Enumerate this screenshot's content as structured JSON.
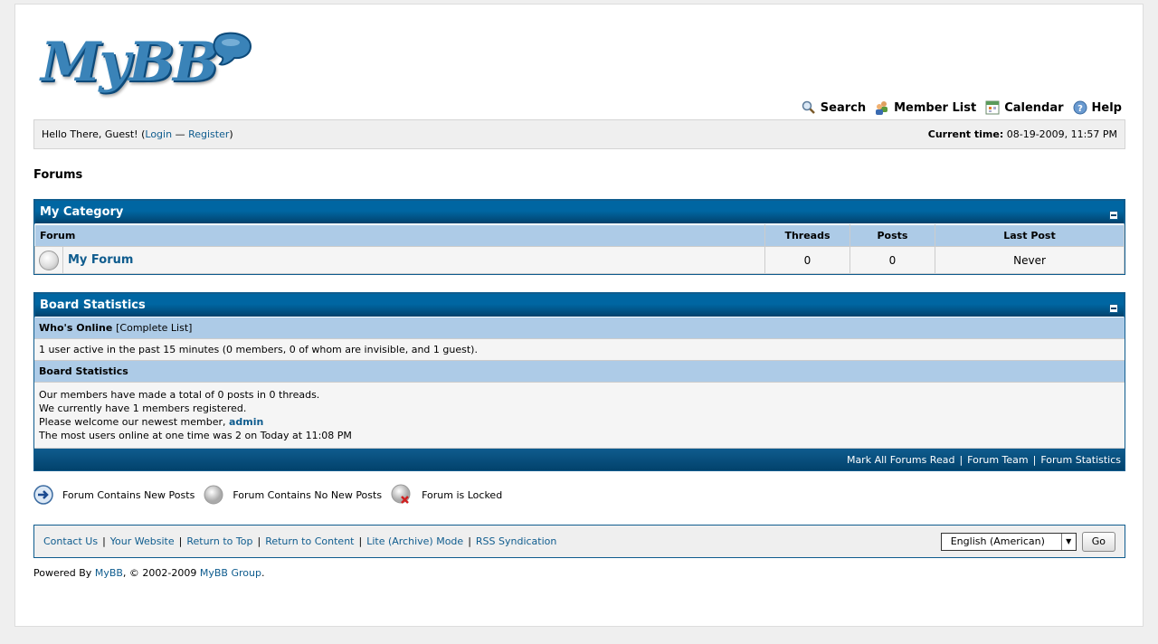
{
  "logo": {
    "text": "MyBB"
  },
  "menu": [
    {
      "label": "Search",
      "icon": "search-icon"
    },
    {
      "label": "Member List",
      "icon": "member-list-icon"
    },
    {
      "label": "Calendar",
      "icon": "calendar-icon"
    },
    {
      "label": "Help",
      "icon": "help-icon"
    }
  ],
  "welcome": {
    "prefix": "Hello There, Guest! (",
    "login": "Login",
    "dash": " — ",
    "register": "Register",
    "suffix": ")",
    "time_label": "Current time:",
    "time_value": "08-19-2009, 11:57 PM"
  },
  "page_title": "Forums",
  "category": {
    "title": "My Category",
    "columns": {
      "forum": "Forum",
      "threads": "Threads",
      "posts": "Posts",
      "last_post": "Last Post"
    },
    "forums": [
      {
        "name": "My Forum",
        "threads": "0",
        "posts": "0",
        "last_post": "Never"
      }
    ]
  },
  "stats": {
    "title": "Board Statistics",
    "whos_online_label": "Who's Online",
    "complete_list": "[Complete List]",
    "online_text": "1 user active in the past 15 minutes (0 members, 0 of whom are invisible, and 1 guest).",
    "board_stats_label": "Board Statistics",
    "line1": "Our members have made a total of 0 posts in 0 threads.",
    "line2": "We currently have 1 members registered.",
    "line3_prefix": "Please welcome our newest member, ",
    "newest_member": "admin",
    "line4": "The most users online at one time was 2 on Today at 11:08 PM",
    "footer_links": [
      "Mark All Forums Read",
      "Forum Team",
      "Forum Statistics"
    ]
  },
  "legend": [
    {
      "label": "Forum Contains New Posts",
      "icon": "new-posts-icon"
    },
    {
      "label": "Forum Contains No New Posts",
      "icon": "no-new-posts-icon"
    },
    {
      "label": "Forum is Locked",
      "icon": "locked-icon"
    }
  ],
  "footer_links": [
    "Contact Us",
    "Your Website",
    "Return to Top",
    "Return to Content",
    "Lite (Archive) Mode",
    "RSS Syndication"
  ],
  "language": {
    "selected": "English (American)",
    "go": "Go"
  },
  "powered": {
    "prefix": "Powered By ",
    "mybb": "MyBB",
    "middle": ", © 2002-2009 ",
    "group": "MyBB Group",
    "suffix": "."
  },
  "colors": {
    "header_blue": "#0066a2",
    "tcat": "#adcbe7",
    "link": "#0f5c8e"
  }
}
